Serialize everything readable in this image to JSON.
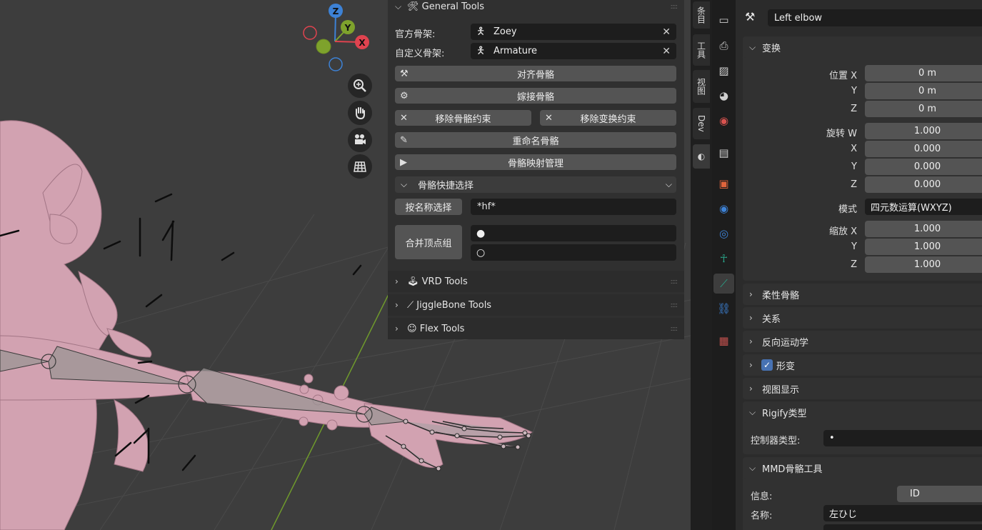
{
  "viewport": {
    "gizmo": {
      "z": "Z",
      "y": "Y",
      "x": "X"
    },
    "nav_icons": [
      "zoom-icon",
      "hand-pan-icon",
      "camera-icon",
      "grid-view-icon"
    ]
  },
  "npanel": {
    "general_tools": {
      "title": "General Tools",
      "official_armature_label": "官方骨架:",
      "official_armature_value": "Zoey",
      "custom_armature_label": "自定义骨架:",
      "custom_armature_value": "Armature",
      "align_bones": "对齐骨骼",
      "graft_bones": "嫁接骨骼",
      "remove_bone_constraints": "移除骨骼约束",
      "remove_transform_constraints": "移除变换约束",
      "rename_bones": "重命名骨骼",
      "bone_mapping": "骨骼映射管理",
      "quick_select": "骨骼快捷选择",
      "select_by_name": "按名称选择",
      "name_pattern": "*hf*",
      "merge_vertex_groups": "合并顶点组"
    },
    "vrd_tools": "VRD Tools",
    "jigglebone_tools": "JiggleBone Tools",
    "flex_tools": "Flex Tools"
  },
  "tabs": [
    "条目",
    "工具",
    "视图",
    "Dev"
  ],
  "properties": {
    "bone_name": "Left elbow",
    "transform": {
      "title": "变换",
      "location_label": "位置 X",
      "location": [
        "0 m",
        "0 m",
        "0 m"
      ],
      "rotation_label": "旋转 W",
      "rotation": [
        "1.000",
        "0.000",
        "0.000",
        "0.000"
      ],
      "mode_label": "模式",
      "mode_value": "四元数运算(WXYZ)",
      "scale_label": "缩放 X",
      "scale": [
        "1.000",
        "1.000",
        "1.000"
      ],
      "axis_y": "Y",
      "axis_z": "Z",
      "axis_x": "X"
    },
    "panels": {
      "bendy_bones": "柔性骨骼",
      "relations": "关系",
      "inverse_kinematics": "反向运动学",
      "deform": "形变",
      "viewport_display": "视图显示",
      "rigify_type": "Rigify类型",
      "rigify_controller_label": "控制器类型:",
      "rigify_controller_value": "•",
      "mmd_bone_tools": "MMD骨骼工具",
      "mmd_info_label": "信息:",
      "mmd_info_value": "ID",
      "mmd_name_label": "名称:",
      "mmd_name_value": "左ひじ"
    },
    "deform_checked": true
  },
  "colors": {
    "accent_blue": "#4772b3",
    "bone_active_teal": "#2aa68a",
    "axis_x_red": "#e0434f",
    "axis_y_green": "#7ea22c",
    "axis_z_blue": "#3d82d6",
    "skin_pink": "#d7a3b2"
  }
}
